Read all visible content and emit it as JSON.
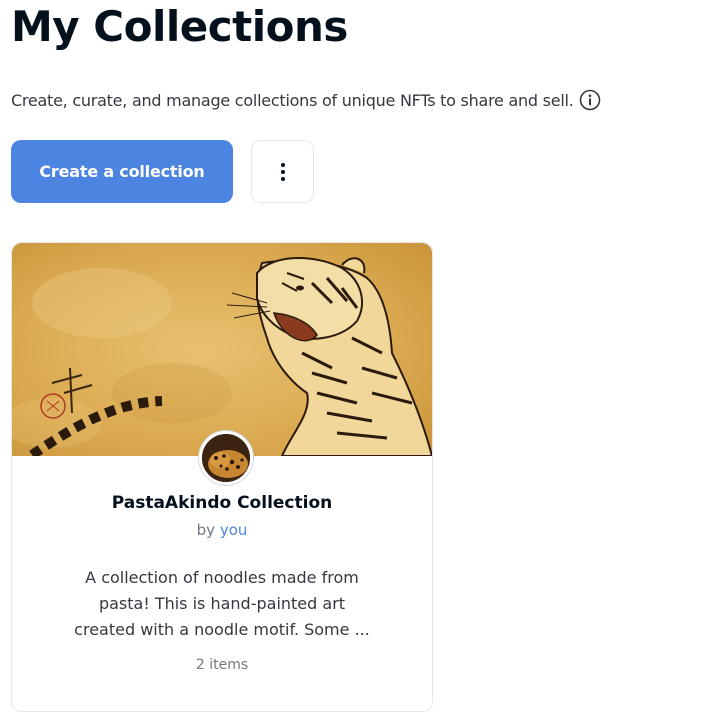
{
  "page": {
    "title": "My Collections",
    "subtitle": "Create, curate, and manage collections of unique NFTs to share and sell."
  },
  "actions": {
    "create_label": "Create a collection",
    "more_icon": "more-vertical-icon",
    "info_icon": "info-icon"
  },
  "colors": {
    "accent": "#4c84e2",
    "text_primary": "#04111d",
    "text_secondary": "#707a83",
    "border": "#e5e8eb",
    "banner_base": "#d9a84e"
  },
  "collections": [
    {
      "name": "PastaAkindo Collection",
      "by_prefix": "by",
      "owner": "you",
      "description_lines": [
        "A collection of noodles made from",
        "pasta! This is hand-painted art",
        "created with a noodle motif. Some ..."
      ],
      "items_count": "2 items",
      "banner": "tiger-painting-image",
      "avatar": "leopard-avatar-image"
    }
  ]
}
